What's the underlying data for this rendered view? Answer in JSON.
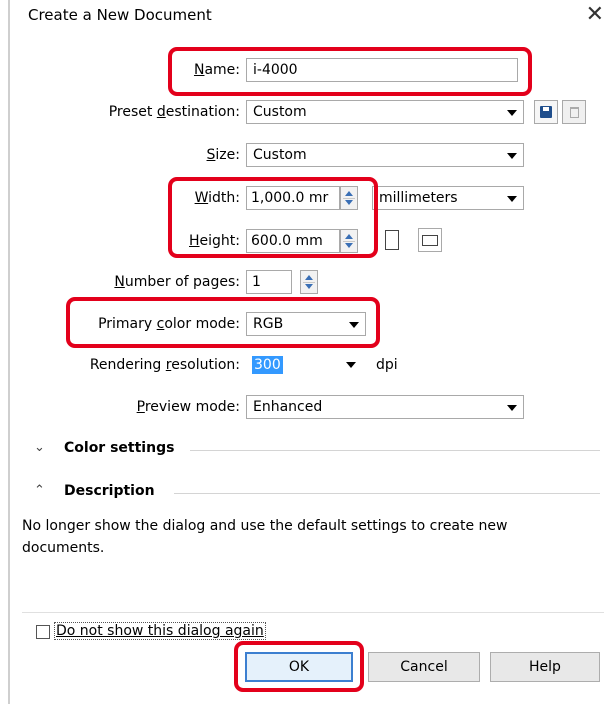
{
  "dialog": {
    "title": "Create a New Document"
  },
  "form": {
    "name": {
      "label_pre": "",
      "label_u": "N",
      "label_post": "ame:",
      "value": "i-4000"
    },
    "preset": {
      "label_pre": "Preset ",
      "label_u": "d",
      "label_post": "estination:",
      "value": "Custom"
    },
    "size": {
      "label_pre": "",
      "label_u": "S",
      "label_post": "ize:",
      "value": "Custom"
    },
    "width": {
      "label_pre": "",
      "label_u": "W",
      "label_post": "idth:",
      "value": "1,000.0 mr"
    },
    "units": {
      "value": "millimeters"
    },
    "height": {
      "label_pre": "",
      "label_u": "H",
      "label_post": "eight:",
      "value": "600.0 mm"
    },
    "pages": {
      "label_pre": "",
      "label_u": "N",
      "label_post": "umber of pages:",
      "value": "1"
    },
    "color_mode": {
      "label_pre": "Primary ",
      "label_u": "c",
      "label_post": "olor mode:",
      "value": "RGB"
    },
    "resolution": {
      "label_pre": "Rendering ",
      "label_u": "r",
      "label_post": "esolution:",
      "value": "300",
      "unit": "dpi"
    },
    "preview": {
      "label_pre": "",
      "label_u": "P",
      "label_post": "review mode:",
      "value": "Enhanced"
    }
  },
  "sections": {
    "color_settings": {
      "label": "Color settings",
      "icon": "chevron-double-down-icon"
    },
    "description": {
      "label": "Description",
      "icon": "chevron-double-up-icon",
      "text": "No longer show the dialog and use the default settings to create new documents."
    }
  },
  "footer": {
    "checkbox_label": "Do not show this dialog again",
    "ok": "OK",
    "cancel": "Cancel",
    "help": "Help"
  },
  "colors": {
    "highlight": "#e3001b",
    "selection": "#3399ff"
  }
}
